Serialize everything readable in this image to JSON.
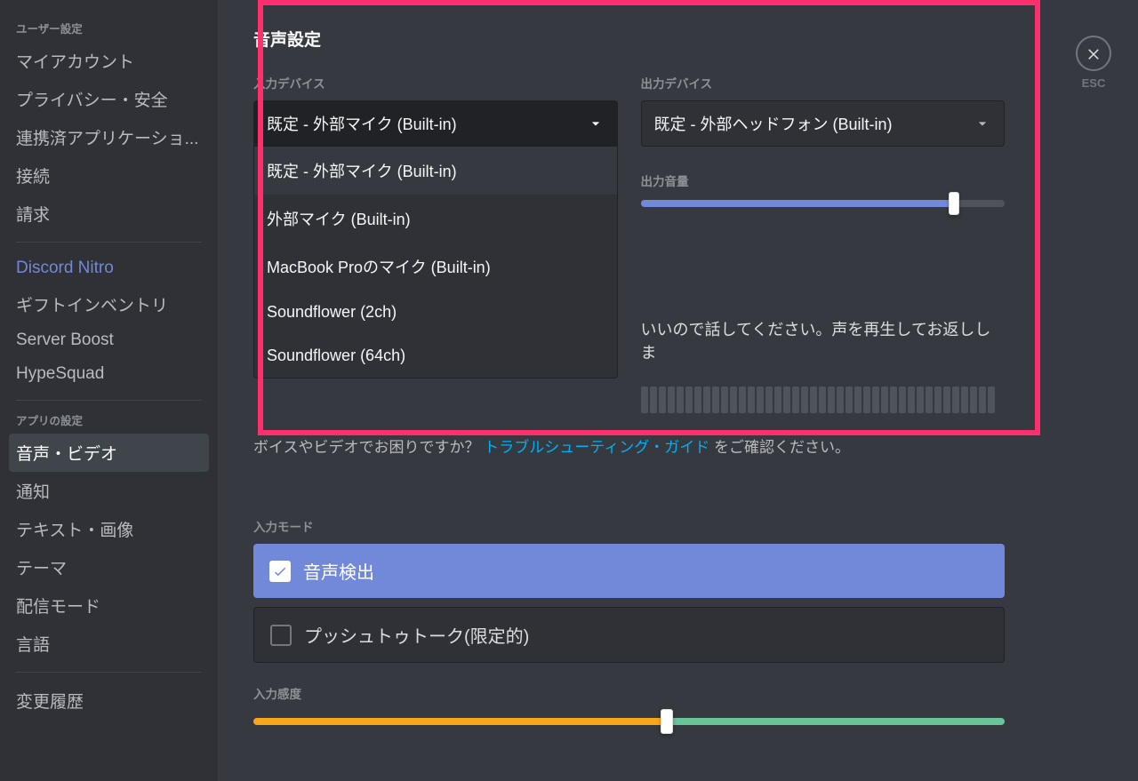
{
  "sidebar": {
    "user_header": "ユーザー設定",
    "items_user": [
      "マイアカウント",
      "プライバシー・安全",
      "連携済アプリケーショ...",
      "接続",
      "請求"
    ],
    "nitro": "Discord Nitro",
    "items_nitro": [
      "ギフトインベントリ",
      "Server Boost",
      "HypeSquad"
    ],
    "app_header": "アプリの設定",
    "items_app": [
      "音声・ビデオ",
      "通知",
      "テキスト・画像",
      "テーマ",
      "配信モード",
      "言語"
    ],
    "changelog": "変更履歴"
  },
  "panel": {
    "title": "音声設定",
    "input_label": "入力デバイス",
    "output_label": "出力デバイス",
    "input_selected": "既定 - 外部マイク (Built-in)",
    "output_selected": "既定 - 外部ヘッドフォン (Built-in)",
    "input_options": [
      "既定 - 外部マイク (Built-in)",
      "外部マイク (Built-in)",
      "MacBook Proのマイク (Built-in)",
      "Soundflower (2ch)",
      "Soundflower (64ch)"
    ],
    "output_volume_label": "出力音量",
    "output_volume_pct": 86,
    "mic_help_fragment": "いいので話してください。声を再生してお返ししま",
    "trouble_prefix": "ボイスやビデオでお困りですか？",
    "trouble_link": "トラブルシューティング・ガイド",
    "trouble_suffix": "をご確認ください。",
    "input_mode_label": "入力モード",
    "mode_voice": "音声検出",
    "mode_ptt": "プッシュトゥトーク(限定的)",
    "sensitivity_label": "入力感度",
    "sensitivity_pct": 55
  },
  "close": {
    "esc": "ESC"
  }
}
